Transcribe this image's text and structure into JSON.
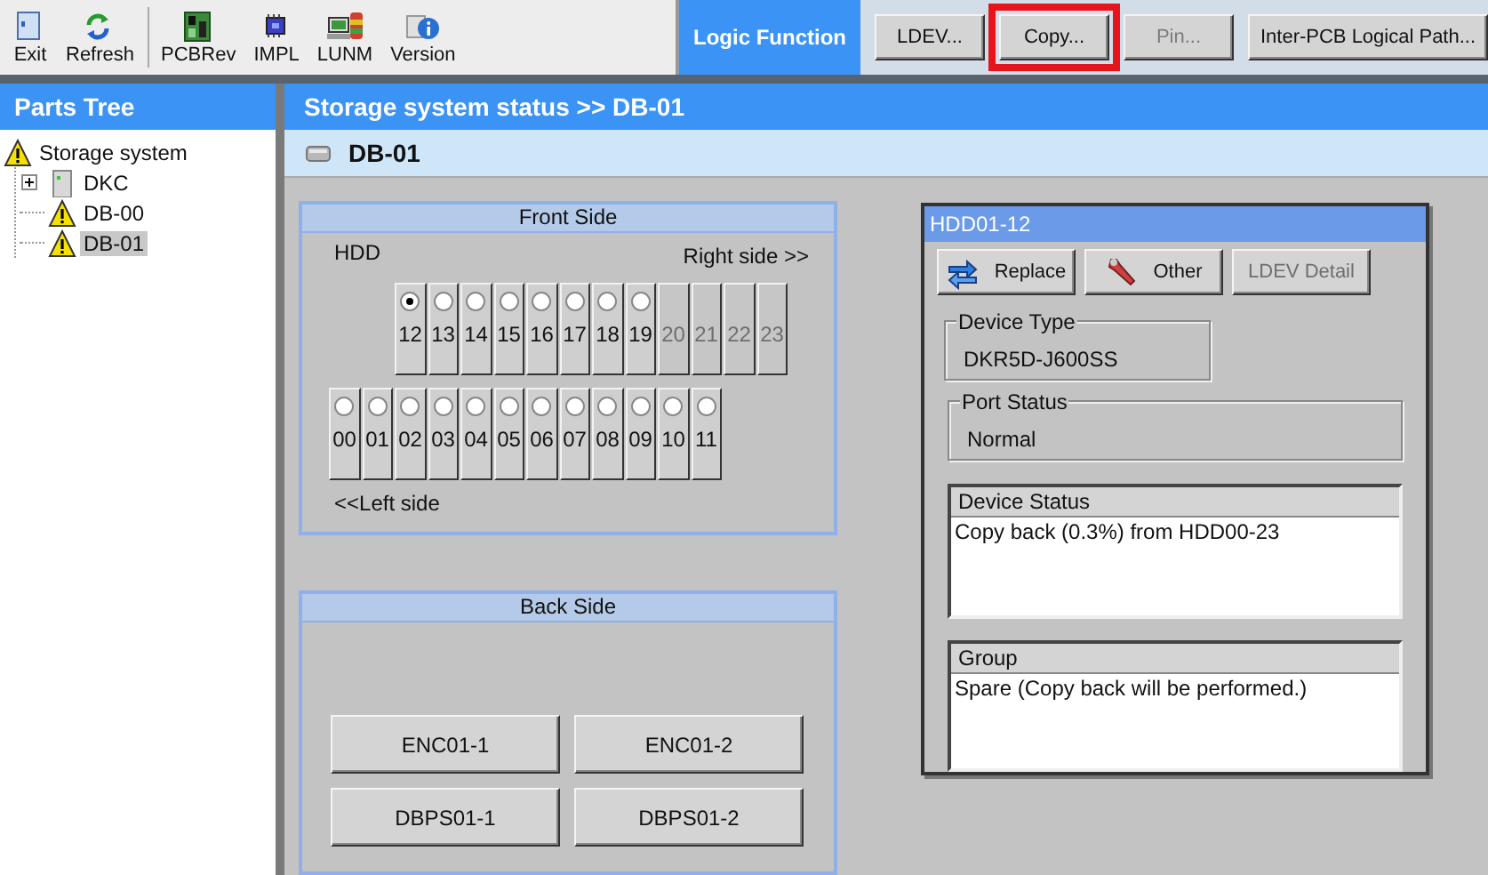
{
  "toolbar": {
    "tools": [
      {
        "label": "Exit",
        "kind": "exit"
      },
      {
        "label": "Refresh",
        "kind": "refresh"
      },
      {
        "label": "PCBRev",
        "kind": "board"
      },
      {
        "label": "IMPL",
        "kind": "chip"
      },
      {
        "label": "LUNM",
        "kind": "terminal"
      },
      {
        "label": "Version",
        "kind": "info"
      }
    ],
    "function_tab": {
      "label": "Logic Function",
      "selected": true
    },
    "buttons": [
      {
        "label": "LDEV...",
        "disabled": false,
        "highlighted": false
      },
      {
        "label": "Copy...",
        "disabled": false,
        "highlighted": true
      },
      {
        "label": "Pin...",
        "disabled": true,
        "highlighted": false
      },
      {
        "label": "Inter-PCB Logical Path...",
        "disabled": false,
        "highlighted": false
      }
    ]
  },
  "sidebar": {
    "title": "Parts Tree",
    "tree": [
      {
        "label": "Storage system",
        "kind": "warning",
        "selected": false,
        "children": [
          {
            "label": "DKC",
            "kind": "server",
            "selected": false,
            "expanded": false
          },
          {
            "label": "DB-00",
            "kind": "warning",
            "selected": false
          },
          {
            "label": "DB-01",
            "kind": "warning",
            "selected": true
          }
        ]
      }
    ]
  },
  "main": {
    "title": "Storage system status >> DB-01",
    "subtitle": "DB-01",
    "front": {
      "title": "Front Side",
      "hdd_label": "HDD",
      "right_label": "Right side >>",
      "left_label": "<<Left side",
      "upper_slots": [
        {
          "label": "12",
          "selected": true,
          "disabled": false
        },
        {
          "label": "13",
          "selected": false,
          "disabled": false
        },
        {
          "label": "14",
          "selected": false,
          "disabled": false
        },
        {
          "label": "15",
          "selected": false,
          "disabled": false
        },
        {
          "label": "16",
          "selected": false,
          "disabled": false
        },
        {
          "label": "17",
          "selected": false,
          "disabled": false
        },
        {
          "label": "18",
          "selected": false,
          "disabled": false
        },
        {
          "label": "19",
          "selected": false,
          "disabled": false
        },
        {
          "label": "20",
          "disabled": true
        },
        {
          "label": "21",
          "disabled": true
        },
        {
          "label": "22",
          "disabled": true
        },
        {
          "label": "23",
          "disabled": true
        }
      ],
      "lower_slots": [
        {
          "label": "00",
          "selected": false,
          "disabled": false
        },
        {
          "label": "01",
          "selected": false,
          "disabled": false
        },
        {
          "label": "02",
          "selected": false,
          "disabled": false
        },
        {
          "label": "03",
          "selected": false,
          "disabled": false
        },
        {
          "label": "04",
          "selected": false,
          "disabled": false
        },
        {
          "label": "05",
          "selected": false,
          "disabled": false
        },
        {
          "label": "06",
          "selected": false,
          "disabled": false
        },
        {
          "label": "07",
          "selected": false,
          "disabled": false
        },
        {
          "label": "08",
          "selected": false,
          "disabled": false
        },
        {
          "label": "09",
          "selected": false,
          "disabled": false
        },
        {
          "label": "10",
          "selected": false,
          "disabled": false
        },
        {
          "label": "11",
          "selected": false,
          "disabled": false
        }
      ]
    },
    "back": {
      "title": "Back Side",
      "buttons": [
        "ENC01-1",
        "ENC01-2",
        "DBPS01-1",
        "DBPS01-2"
      ]
    },
    "detail": {
      "title": "HDD01-12",
      "buttons": [
        {
          "label": "Replace",
          "kind": "swap",
          "disabled": false
        },
        {
          "label": "Other",
          "kind": "wrench",
          "disabled": false
        },
        {
          "label": "LDEV Detail",
          "disabled": true
        }
      ],
      "device_type": {
        "label": "Device Type",
        "value": "DKR5D-J600SS"
      },
      "port_status": {
        "label": "Port Status",
        "value": "Normal"
      },
      "device_status": {
        "label": "Device Status",
        "text": "Copy back (0.3%) from HDD00-23"
      },
      "group": {
        "label": "Group",
        "text": "Spare (Copy back will be performed.)"
      }
    }
  }
}
